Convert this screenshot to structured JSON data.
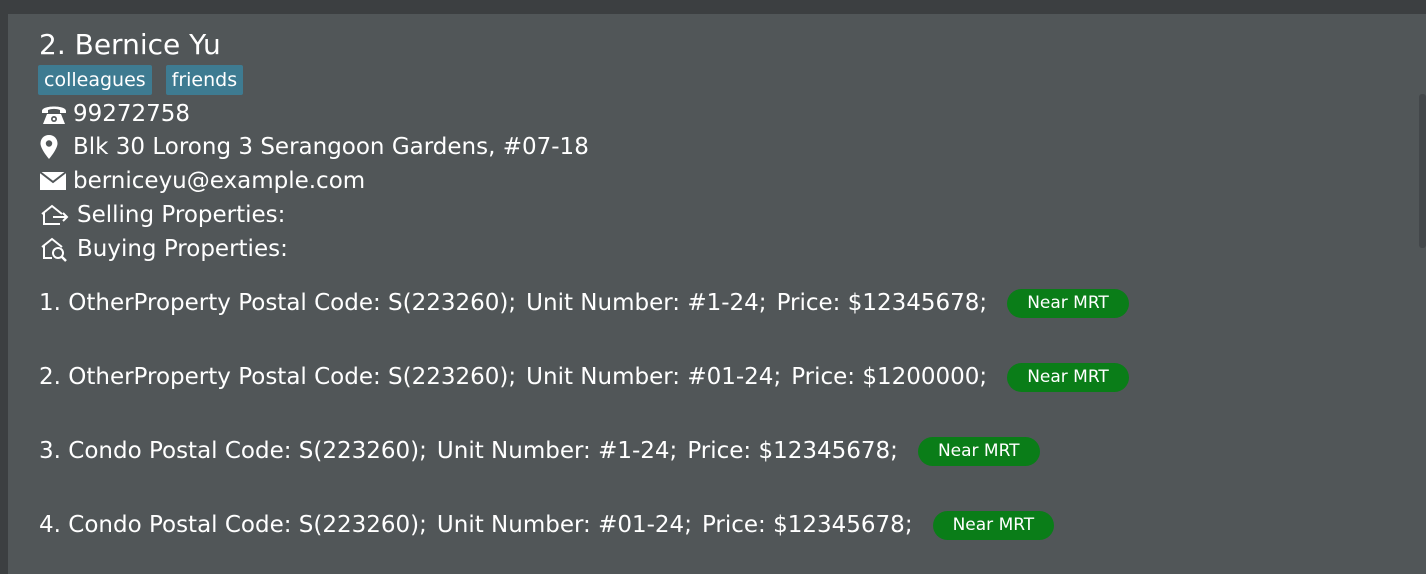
{
  "person": {
    "name": "2. Bernice Yu",
    "tags": [
      "colleagues",
      "friends"
    ],
    "phone": "99272758",
    "address": "Blk 30 Lorong 3 Serangoon Gardens, #07-18",
    "email": "berniceyu@example.com",
    "selling_label": "Selling Properties:",
    "buying_label": "Buying Properties:"
  },
  "icons": {
    "phone": "phone-icon",
    "address": "location-pin-icon",
    "email": "envelope-icon",
    "selling": "house-arrow-icon",
    "buying": "house-search-icon"
  },
  "properties": [
    {
      "title": "1. OtherProperty Postal Code: S(223260);",
      "unit": "Unit Number: #1-24;",
      "price": "Price: $12345678;",
      "tag": "Near MRT"
    },
    {
      "title": "2. OtherProperty Postal Code: S(223260);",
      "unit": "Unit Number: #01-24;",
      "price": "Price: $1200000;",
      "tag": "Near MRT"
    },
    {
      "title": "3. Condo Postal Code: S(223260);",
      "unit": "Unit Number: #1-24;",
      "price": "Price: $12345678;",
      "tag": "Near MRT"
    },
    {
      "title": "4. Condo Postal Code: S(223260);",
      "unit": "Unit Number: #01-24;",
      "price": "Price: $12345678;",
      "tag": "Near MRT"
    }
  ],
  "colors": {
    "card_background": "#515658",
    "tag_background": "#3e7b91",
    "badge_background": "#0a7d18",
    "text": "#ffffff"
  }
}
